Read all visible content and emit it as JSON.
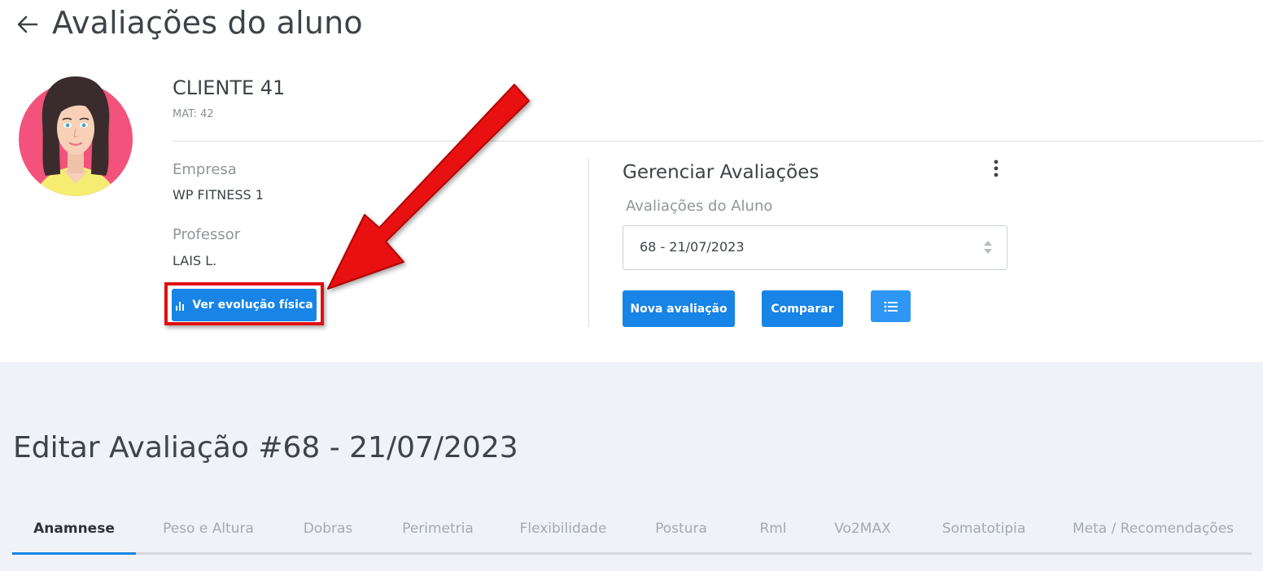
{
  "page": {
    "title": "Avaliações do aluno"
  },
  "client": {
    "name": "CLIENTE 41",
    "mat": "MAT: 42",
    "empresa_label": "Empresa",
    "empresa": "WP FITNESS 1",
    "professor_label": "Professor",
    "professor": "LAIS L.",
    "evolution_button": "Ver evolução física"
  },
  "manage": {
    "title": "Gerenciar Avaliações",
    "select_label": "Avaliações do Aluno",
    "selected": "68 - 21/07/2023",
    "new_button": "Nova avaliação",
    "compare_button": "Comparar"
  },
  "edit": {
    "title": "Editar Avaliação #68 - 21/07/2023"
  },
  "tabs": [
    {
      "label": "Anamnese",
      "active": true
    },
    {
      "label": "Peso e Altura"
    },
    {
      "label": "Dobras"
    },
    {
      "label": "Perimetria"
    },
    {
      "label": "Flexibilidade"
    },
    {
      "label": "Postura"
    },
    {
      "label": "Rml"
    },
    {
      "label": "Vo2MAX"
    },
    {
      "label": "Somatotipia"
    },
    {
      "label": "Meta / Recomendações"
    }
  ],
  "icons": {
    "back": "arrow-left-icon",
    "chart": "bar-chart-icon",
    "kebab": "more-vertical-icon",
    "list": "list-icon",
    "select": "sort-arrows-icon"
  },
  "colors": {
    "primary": "#1784e6",
    "highlight": "#e01010",
    "background_lower": "#eff2f7"
  }
}
